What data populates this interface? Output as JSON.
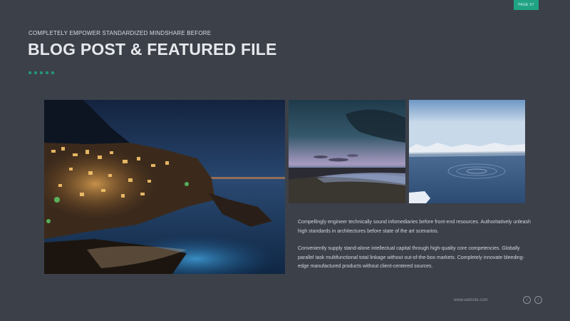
{
  "page_badge": "PAGE 07",
  "header": {
    "subtitle": "COMPLETELY EMPOWER STANDARDIZED MINDSHARE BEFORE",
    "title": "BLOG POST & FEATURED FILE"
  },
  "accent_color": "#1fa383",
  "images": {
    "main": "night-coastal-village-photo",
    "beach": "twilight-beach-photo",
    "ice": "icebergs-water-photo"
  },
  "body": {
    "paragraph_1": "Compellingly engineer technically sound infomediaries before front-end resources. Authoritatively unleash high standards in architectures before state of the art scenarios.",
    "paragraph_2": "Conveniently supply stand-alone intellectual capital through high-quality core competencies. Globally parallel task multifunctional total linkage without out-of-the-box markets. Completely innovate bleeding-edge manufactured products without client-centered sources."
  },
  "footer": {
    "url": "www.website.com",
    "prev_icon": "chevron-left-icon",
    "next_icon": "chevron-right-icon",
    "prev_glyph": "‹",
    "next_glyph": "›"
  }
}
